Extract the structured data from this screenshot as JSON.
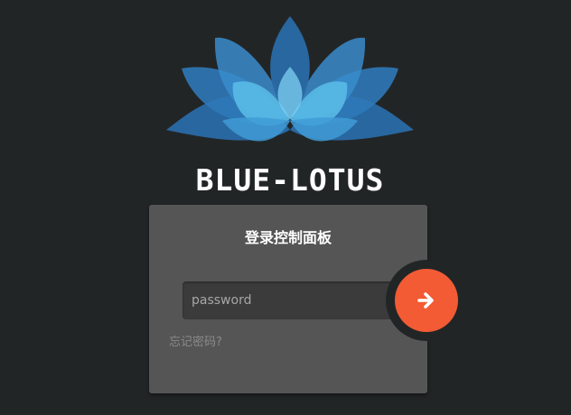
{
  "logo": {
    "text": "BLUE-LOTUS",
    "icon": "lotus-icon"
  },
  "login": {
    "title": "登录控制面板",
    "password_placeholder": "password",
    "password_value": "",
    "forgot_label": "忘记密码?",
    "submit_icon": "arrow-right-icon"
  },
  "colors": {
    "background": "#222526",
    "panel": "#555555",
    "accent": "#f25b34",
    "lotus_dark": "#2a6aa6",
    "lotus_light": "#5bbde8"
  }
}
